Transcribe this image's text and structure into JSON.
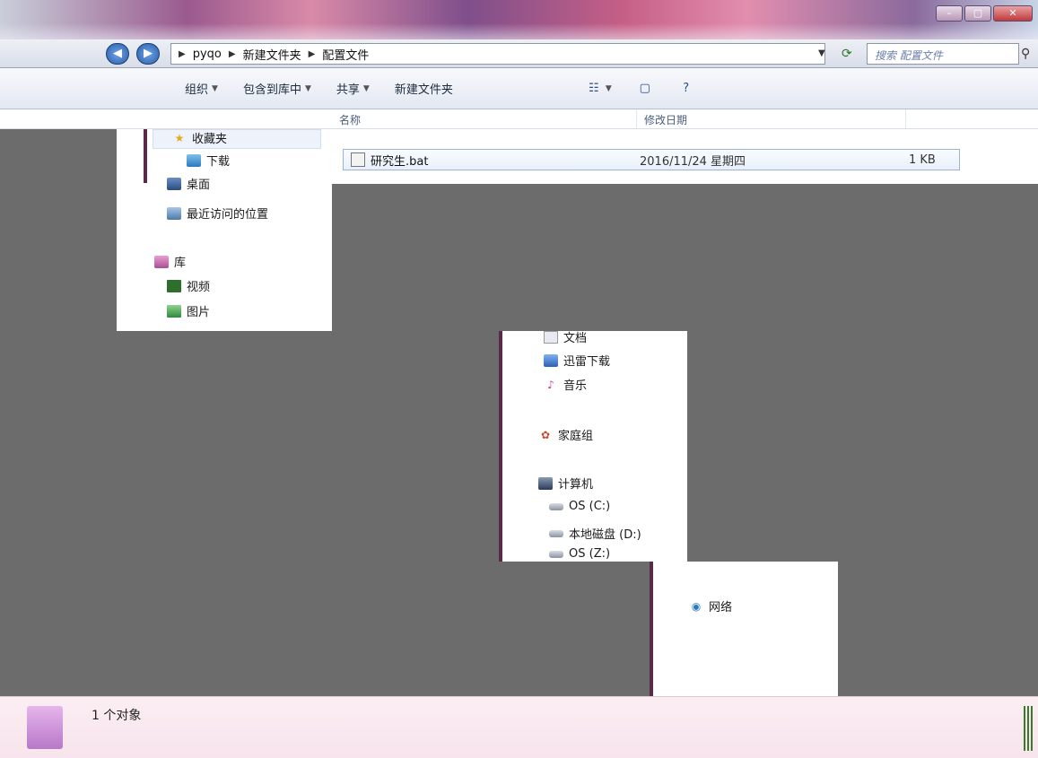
{
  "address": {
    "crumbs": [
      "pyqo",
      "新建文件夹",
      "配置文件"
    ],
    "search_placeholder": "搜索 配置文件"
  },
  "toolbar": {
    "items": [
      "组织",
      "包含到库中",
      "共享",
      "新建文件夹"
    ]
  },
  "columns": {
    "name": "名称",
    "date": "修改日期"
  },
  "nav": {
    "favorites": "收藏夹",
    "downloads": "下载",
    "desktop": "桌面",
    "recent": "最近访问的位置",
    "library": "库",
    "videos": "视频",
    "pictures": "图片",
    "documents": "文档",
    "thunder": "迅雷下载",
    "music": "音乐",
    "homegroup": "家庭组",
    "computer": "计算机",
    "drive_c": "OS (C:)",
    "drive_d": "本地磁盘 (D:)",
    "drive_z": "OS (Z:)",
    "network": "网络"
  },
  "files": [
    {
      "name": "研究生.bat",
      "date": "2016/11/24 星期四",
      "size": "1 KB"
    }
  ],
  "status": {
    "count": "1 个对象"
  }
}
